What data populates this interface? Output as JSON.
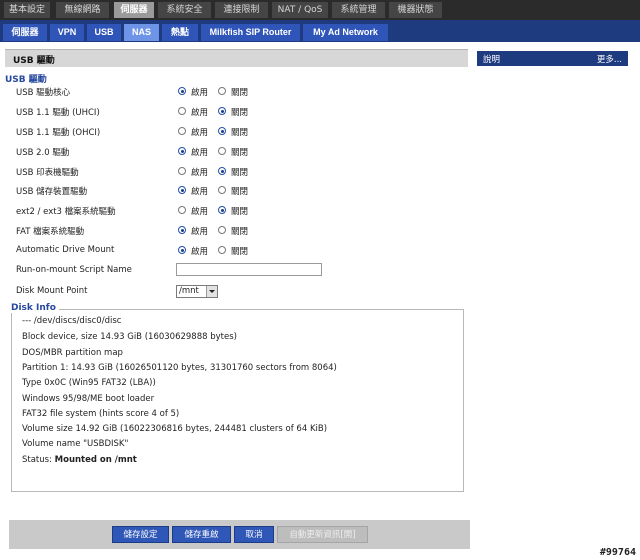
{
  "top_tabs": [
    "基本設定",
    "無線網路",
    "伺服器",
    "系統安全",
    "連接限制",
    "NAT / QoS",
    "系統管理",
    "機器狀態"
  ],
  "sub_tabs": [
    "伺服器",
    "VPN",
    "USB",
    "NAS",
    "熱點",
    "Milkfish SIP Router",
    "My Ad Network"
  ],
  "panel_title": "USB 驅動",
  "section_usb": "USB 驅動",
  "enable_label": "啟用",
  "disable_label": "關閉",
  "settings": [
    {
      "label": "USB 驅動核心",
      "enabled": true
    },
    {
      "label": "USB 1.1 驅動 (UHCI)",
      "enabled": false
    },
    {
      "label": "USB 1.1 驅動 (OHCI)",
      "enabled": false
    },
    {
      "label": "USB 2.0 驅動",
      "enabled": true
    },
    {
      "label": "USB 印表機驅動",
      "enabled": false
    },
    {
      "label": "USB 儲存裝置驅動",
      "enabled": true
    },
    {
      "label": "ext2 / ext3 檔案系統驅動",
      "enabled": false
    },
    {
      "label": "FAT 檔案系統驅動",
      "enabled": true
    },
    {
      "label": "Automatic Drive Mount",
      "enabled": true
    }
  ],
  "script_label": "Run-on-mount Script Name",
  "script_value": "",
  "mount_label": "Disk Mount Point",
  "mount_value": "/mnt",
  "section_diskinfo": "Disk Info",
  "disk_info": [
    "--- /dev/discs/disc0/disc",
    "Block device, size 14.93 GiB (16030629888 bytes)",
    "DOS/MBR partition map",
    "Partition 1: 14.93 GiB (16026501120 bytes, 31301760 sectors from 8064)",
    "Type 0x0C (Win95 FAT32 (LBA))",
    "Windows 95/98/ME boot loader",
    "FAT32 file system (hints score 4 of 5)",
    "Volume size 14.92 GiB (16022306816 bytes, 244481 clusters of 64 KiB)",
    "Volume name \"USBDISK\""
  ],
  "status_label": "Status:",
  "status_value": "Mounted on /mnt",
  "buttons": {
    "save": "儲存設定",
    "save_reboot": "儲存重啟",
    "cancel": "取消",
    "auto_refresh": "自動更新資訊[開]"
  },
  "help": {
    "title": "說明",
    "more": "更多..."
  },
  "watermark": "#99764"
}
